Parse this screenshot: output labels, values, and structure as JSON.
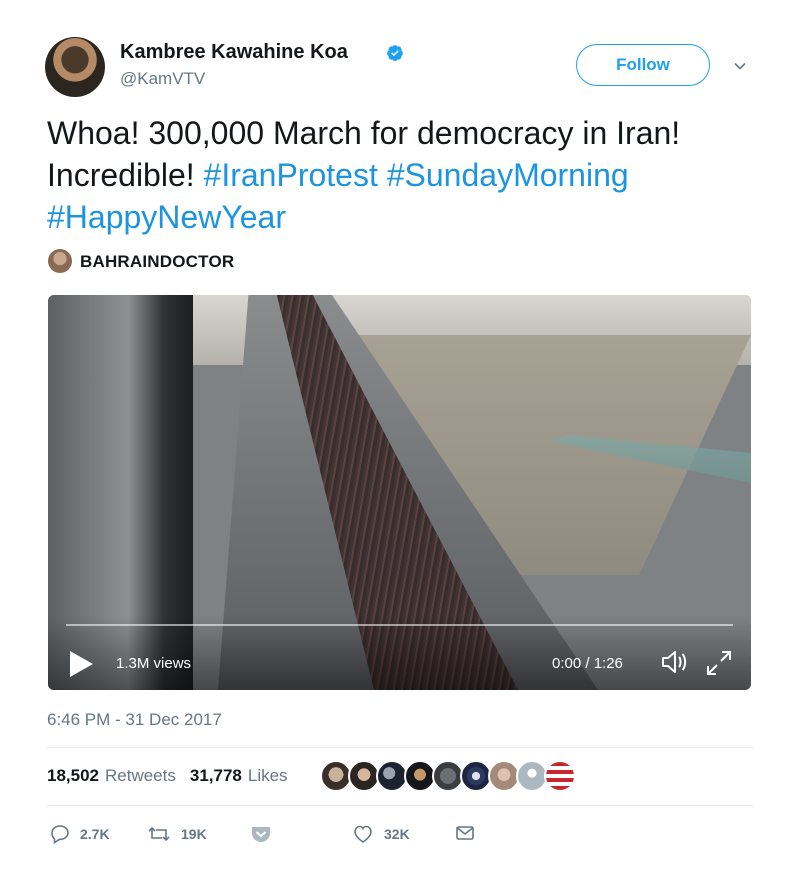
{
  "author": {
    "name": "Kambree Kawahine Koa",
    "handle": "@KamVTV",
    "verified": true,
    "follow_label": "Follow"
  },
  "tweet": {
    "text_plain": "Whoa! 300,000 March for democracy in Iran! Incredible! ",
    "hashtags": [
      "#IranProtest",
      "#SundayMorning",
      "#HappyNewYear"
    ]
  },
  "media_credit": "BAHRAINDOCTOR",
  "video": {
    "views": "1.3M views",
    "time": "0:00 / 1:26"
  },
  "timestamp": "6:46 PM - 31 Dec 2017",
  "stats": {
    "retweets_count": "18,502",
    "retweets_label": "Retweets",
    "likes_count": "31,778",
    "likes_label": "Likes"
  },
  "actions": {
    "replies": "2.7K",
    "retweets": "19K",
    "likes": "32K"
  },
  "colors": {
    "accent": "#1da1f2",
    "hashtag": "#1b95e0",
    "muted": "#657786"
  }
}
